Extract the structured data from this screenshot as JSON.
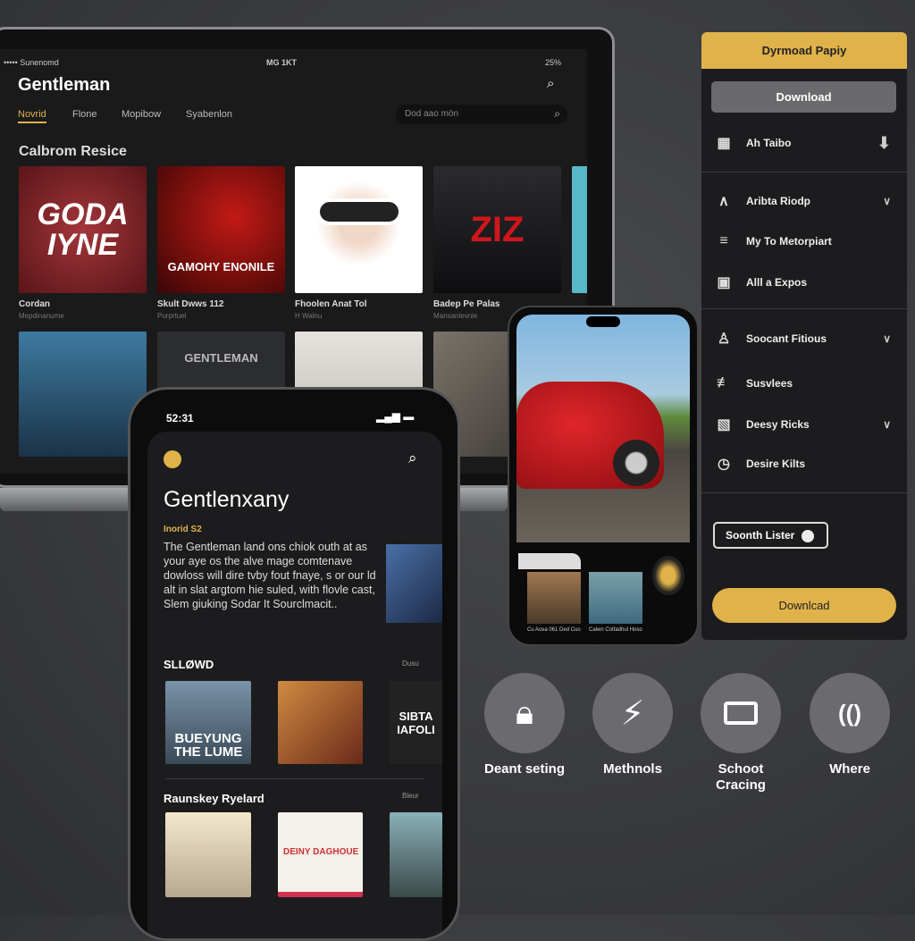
{
  "laptop": {
    "status": {
      "left": "••••• Sunenomd",
      "center": "MG 1KT",
      "right": "25%"
    },
    "title": "Gentleman",
    "tabs": [
      {
        "label": "Novrid",
        "active": true
      },
      {
        "label": "Flone"
      },
      {
        "label": "Mopibow"
      },
      {
        "label": "Syabenlon"
      }
    ],
    "search_placeholder": "Dod aao mön",
    "section_title": "Calbrom Resice",
    "row1": [
      {
        "poster_text": "GODA IYNE",
        "title": "Cordan",
        "sub": "Mepdinanume",
        "color": "#7a1f22"
      },
      {
        "poster_text": "GAMOHY ENONILE",
        "title": "Skult Dwws 112",
        "sub": "Purprtuel",
        "color": "#6a0e0e"
      },
      {
        "poster_text": "",
        "title": "Fhoolen Anat Tol",
        "sub": "H Walnu",
        "color": "#f2f2f2"
      },
      {
        "poster_text": "ZIZ",
        "title": "Badep Pe Palas",
        "sub": "Mansanlevnie",
        "color": "#151517"
      }
    ],
    "row2": [
      {
        "poster_text": "",
        "color": "#2b4e6a"
      },
      {
        "poster_text": "GENTLEMAN",
        "color": "#2b2d30"
      },
      {
        "poster_text": "",
        "color": "#d9d6d2"
      },
      {
        "poster_text": "",
        "color": "#5b5650"
      }
    ]
  },
  "panel": {
    "header": "Dyrmoad Papiy",
    "download_gray": "Download",
    "items": [
      {
        "label": "Ah Taibo",
        "icon": "film-icon",
        "trail": "download-circle-icon"
      },
      {
        "label": "Aribta Riodp",
        "icon": "compass-icon",
        "trail": "chevron-down"
      },
      {
        "label": "My To Metorpiart",
        "icon": "menu-icon"
      },
      {
        "label": "Alll a Expos",
        "icon": "frame-icon"
      },
      {
        "label": "Soocant Fitious",
        "icon": "user-icon",
        "trail": "chevron-down"
      },
      {
        "label": "Susvlees",
        "icon": "equalizer-icon"
      },
      {
        "label": "Deesy Ricks",
        "icon": "edit-icon",
        "trail": "chevron-down"
      },
      {
        "label": "Desire Kilts",
        "icon": "clock-icon"
      }
    ],
    "outline_button": "Soonth Lister",
    "download_gold": "Downlcad"
  },
  "phone_right": {
    "captions": [
      "Cu Acea 061 Ded Cuo",
      "Calwn Cotfadhul Hoso"
    ]
  },
  "phone_left": {
    "time": "52:31",
    "title": "Gentlenxany",
    "subtitle": "Inorid S2",
    "description": "The Gentleman land ons chiok outh at as your aye os the alve mage comtenave dowloss will dire tvby fout fnaye, s or our ld alt in slat argtom hie suled, with flovle cast, Slem giuking Sodar It Sourclmacit..",
    "section1": {
      "title": "SLLØWD",
      "more": "Dusu",
      "posters": [
        {
          "text": "BUEYUNG THE LUME",
          "color": "#4a6a80"
        },
        {
          "text": "",
          "color": "#a0532a"
        },
        {
          "text": "SIBTA IAFOLI",
          "color": "#222"
        }
      ]
    },
    "section2": {
      "title": "Raunskey Ryelard",
      "more": "Bleur",
      "posters": [
        {
          "text": "",
          "color": "#efe3c4"
        },
        {
          "text": "DEINY DAGHOUE",
          "color": "#f4f0ea"
        },
        {
          "text": "",
          "color": "#5d7a84"
        }
      ]
    }
  },
  "actions": [
    {
      "label": "Deant seting",
      "icon": "lock-icon"
    },
    {
      "label": "Methnols",
      "icon": "lightning-icon"
    },
    {
      "label": "Schoot Cracing",
      "icon": "card-icon"
    },
    {
      "label": "Where",
      "icon": "cast-icon"
    }
  ],
  "colors": {
    "accent": "#e0b24a",
    "panel": "#1c1c1e",
    "background": "#3a3b3e"
  }
}
